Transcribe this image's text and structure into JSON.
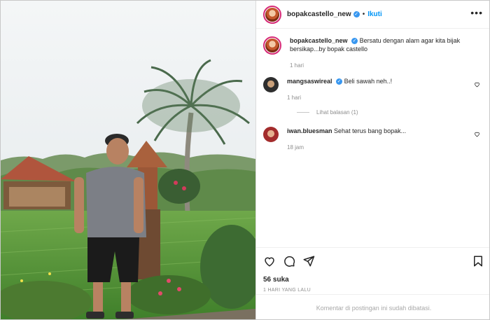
{
  "post": {
    "username": "bopakcastello_new",
    "follow_label": "Ikuti",
    "more_label": "•••",
    "caption": "Bersatu dengan alam agar kita bijak bersikap...by bopak castello",
    "caption_time": "1 hari"
  },
  "comments": [
    {
      "username": "mangsaswireal",
      "text": "Beli sawah neh..!",
      "time": "1 hari",
      "verified": true,
      "replies_label": "Lihat balasan (1)"
    },
    {
      "username": "iwan.bluesman",
      "text": "Sehat terus bang bopak...",
      "time": "18 jam",
      "verified": false
    }
  ],
  "footer": {
    "likes": "56 suka",
    "timestamp": "1 HARI YANG LALU",
    "comments_closed": "Komentar di postingan ini sudah dibatasi."
  },
  "icons": {
    "like": "heart-icon",
    "comment": "comment-icon",
    "share": "share-icon",
    "save": "bookmark-icon",
    "verified": "verified-badge-icon",
    "more": "more-icon"
  },
  "colors": {
    "link_blue": "#0095f6",
    "verified_blue": "#3897f0",
    "muted": "#8e8e8e",
    "text": "#262626",
    "story_ring": "#d62976"
  }
}
